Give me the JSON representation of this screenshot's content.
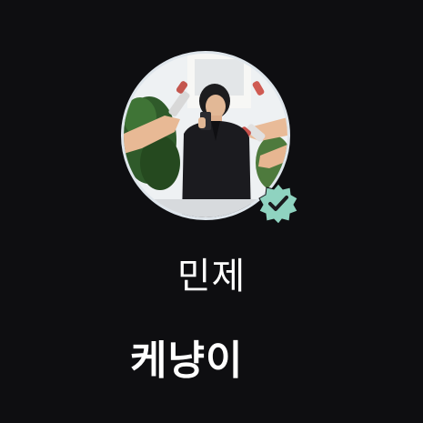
{
  "profile": {
    "avatar_icon": "profile-photo",
    "verified_icon": "verified-check-badge",
    "badge_color": "#8fd3c0",
    "name": "민제",
    "subtitle": "케냥이"
  }
}
